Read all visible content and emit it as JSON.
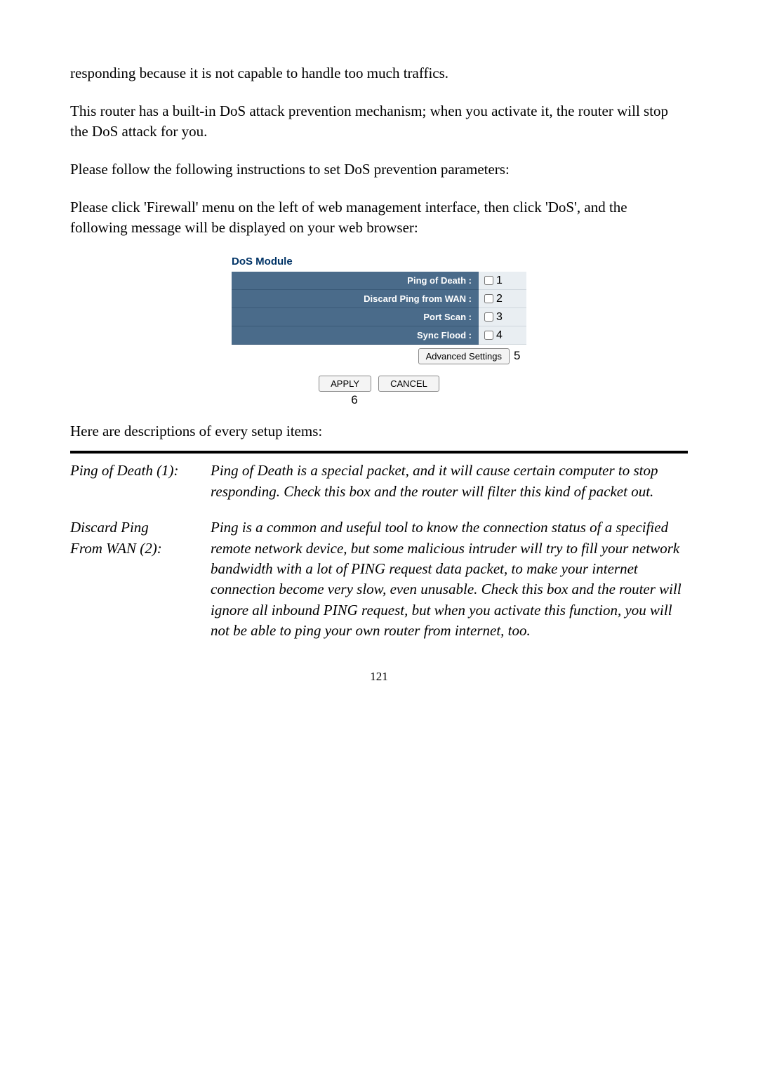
{
  "para1": "responding because it is not capable to handle too much traffics.",
  "para2": "This router has a built-in DoS attack prevention mechanism; when you activate it, the router will stop the DoS attack for you.",
  "para3": "Please follow the following instructions to set DoS prevention parameters:",
  "para4": "Please click 'Firewall' menu on the left of web management interface, then click 'DoS', and the following message will be displayed on your web browser:",
  "module": {
    "title": "DoS Module",
    "rows": {
      "r1": {
        "label": "Ping of Death :",
        "num": "1"
      },
      "r2": {
        "label": "Discard Ping from WAN :",
        "num": "2"
      },
      "r3": {
        "label": "Port Scan :",
        "num": "3"
      },
      "r4": {
        "label": "Sync Flood :",
        "num": "4"
      }
    },
    "adv_label": "Advanced Settings",
    "adv_num": "5",
    "apply": "APPLY",
    "cancel": "CANCEL",
    "six": "6"
  },
  "desc_intro": "Here are descriptions of every setup items:",
  "items": {
    "i1": {
      "label": "Ping of Death (1):",
      "text": "Ping of Death is a special packet, and it will cause certain computer to stop responding. Check this box and the router will filter this kind of packet out."
    },
    "i2": {
      "label1": "Discard Ping",
      "label2": "From WAN (2):",
      "text": "Ping is a common and useful tool to know the connection status of a specified remote network device, but some malicious intruder will try to fill your network bandwidth with a lot of PING request data packet, to make your internet connection become very slow, even unusable. Check this box and the router will ignore all inbound PING request, but when you activate this function, you will not be able to ping your own router from internet, too."
    }
  },
  "pagenum": "121"
}
